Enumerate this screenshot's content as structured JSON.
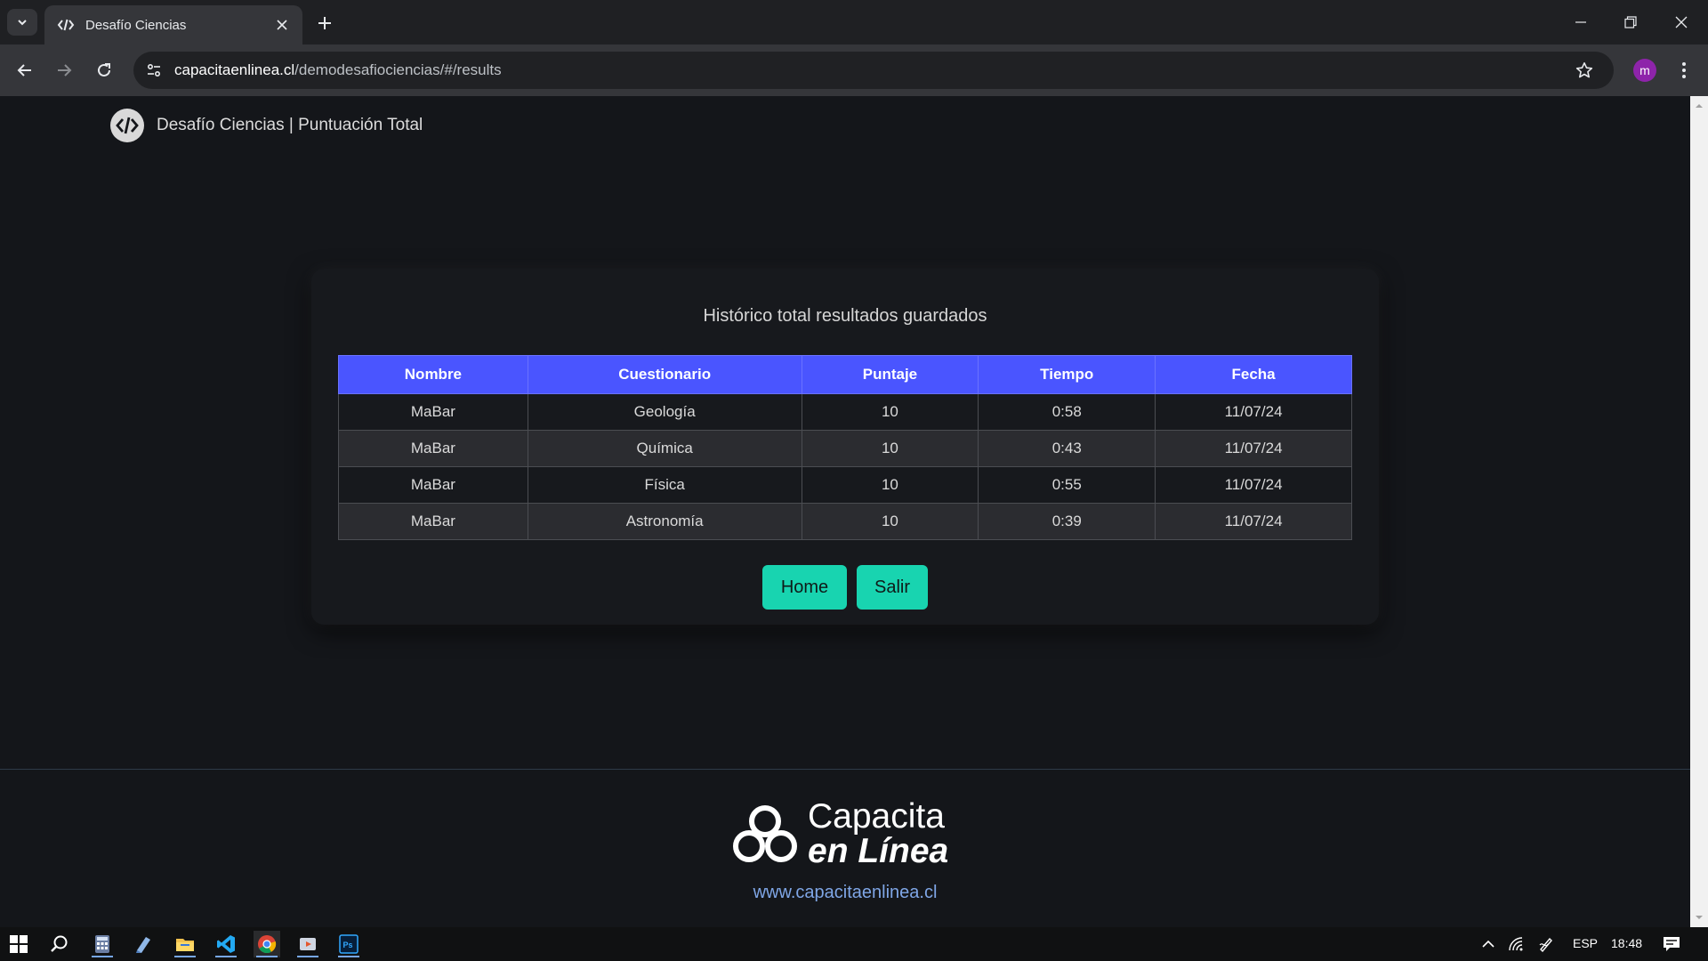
{
  "browser": {
    "tab_title": "Desafío Ciencias",
    "url_host": "capacitaenlinea.cl",
    "url_path": "/demodesafiociencias/#/results",
    "profile_initial": "m"
  },
  "header": {
    "title": "Desafío Ciencias | Puntuación Total"
  },
  "card": {
    "title": "Histórico total resultados guardados",
    "columns": [
      "Nombre",
      "Cuestionario",
      "Puntaje",
      "Tiempo",
      "Fecha"
    ],
    "rows": [
      [
        "MaBar",
        "Geología",
        "10",
        "0:58",
        "11/07/24"
      ],
      [
        "MaBar",
        "Química",
        "10",
        "0:43",
        "11/07/24"
      ],
      [
        "MaBar",
        "Física",
        "10",
        "0:55",
        "11/07/24"
      ],
      [
        "MaBar",
        "Astronomía",
        "10",
        "0:39",
        "11/07/24"
      ]
    ],
    "buttons": {
      "home": "Home",
      "exit": "Salir"
    }
  },
  "footer": {
    "logo_line1": "Capacita",
    "logo_line2": "en Línea",
    "link": "www.capacitaenlinea.cl"
  },
  "taskbar": {
    "language": "ESP",
    "time": "18:48",
    "apps": [
      "start-icon",
      "search-icon",
      "calculator-icon",
      "notes-icon",
      "file-explorer-icon",
      "vscode-icon",
      "chrome-icon",
      "media-player-icon",
      "photoshop-icon"
    ]
  },
  "colors": {
    "table_header": "#4a55ff",
    "button": "#18d4b0",
    "page_bg": "#14161a"
  }
}
